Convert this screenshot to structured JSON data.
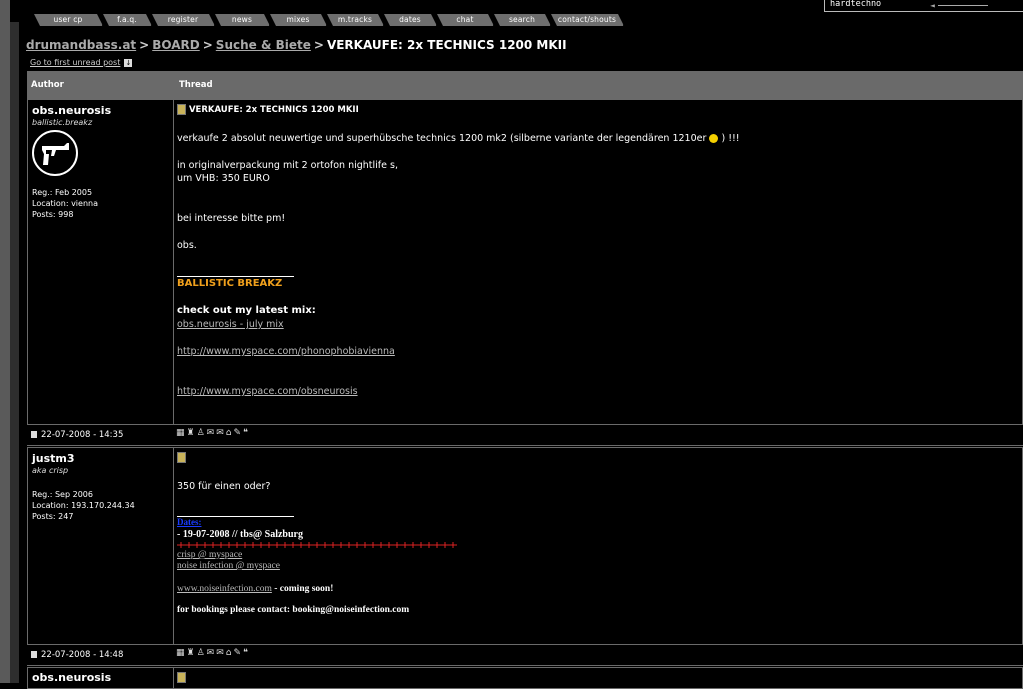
{
  "nav": {
    "tabs": [
      "user cp",
      "f.a.q.",
      "register",
      "news",
      "mixes",
      "m.tracks",
      "dates",
      "chat",
      "search",
      "contact/shouts"
    ]
  },
  "genre_select": {
    "value": "hardtechno"
  },
  "breadcrumb": {
    "site": "drumandbass.at",
    "board": "BOARD",
    "forum": "Suche & Biete",
    "sep": ">",
    "thread": "VERKAUFE: 2x TECHNICS 1200 MKII"
  },
  "first_unread": "Go to first unread post",
  "table": {
    "author_header": "Author",
    "thread_header": "Thread"
  },
  "posts": [
    {
      "author": "obs.neurosis",
      "user_title": "ballistic.breakz",
      "reg": "Reg.: Feb 2005",
      "location": "Location: vienna",
      "posts": "Posts: 998",
      "title": "VERKAUFE: 2x TECHNICS 1200 MKII",
      "body_1": "verkaufe 2 absolut neuwertige und superhübsche technics 1200 mk2 (silberne variante der legendären 1210er",
      "body_1_end": ") !!!",
      "body_2a": "in originalverpackung mit 2 ortofon nightlife s,",
      "body_2b": "um VHB: 350 EURO",
      "body_3": "bei interesse bitte pm!",
      "body_4": "obs.",
      "sig_title": "BALLISTIC BREAKZ",
      "sig_mix_heading": "check out my latest mix:",
      "sig_mix_link": "obs.neurosis - july mix",
      "sig_link_1": "http://www.myspace.com/phonophobiavienna",
      "sig_link_2": "http://www.myspace.com/obsneurosis",
      "date": "22-07-2008 - 14:35"
    },
    {
      "author": "justm3",
      "user_title": "aka crisp",
      "reg": "Reg.: Sep 2006",
      "location": "Location: 193.170.244.34",
      "posts": "Posts: 247",
      "body_1": "350 für einen oder?",
      "sig_dates": "Dates:",
      "sig_date_1": "- 19-07-2008 // tbs@ Salzburg",
      "sig_link_1": "crisp @ myspace",
      "sig_link_2": "noise infection @ myspace",
      "sig_web": "www.noiseinfection.com",
      "sig_web_suffix": "- coming soon!",
      "sig_booking": "for bookings please contact: booking@noiseinfection.com",
      "date": "22-07-2008 - 14:48"
    },
    {
      "author": "obs.neurosis"
    }
  ]
}
